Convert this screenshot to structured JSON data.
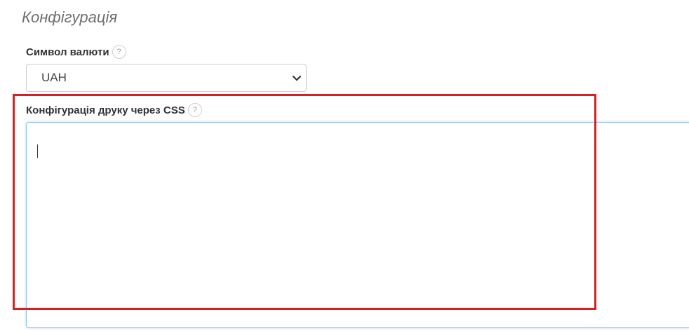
{
  "section": {
    "title": "Конфігурація"
  },
  "currency": {
    "label": "Символ валюти",
    "help": "?",
    "selected": "UAH"
  },
  "css_config": {
    "label": "Конфігурація друку через CSS",
    "help": "?",
    "value": ""
  },
  "colors": {
    "highlight": "#d62121",
    "focus_border": "#8fc1ea"
  }
}
